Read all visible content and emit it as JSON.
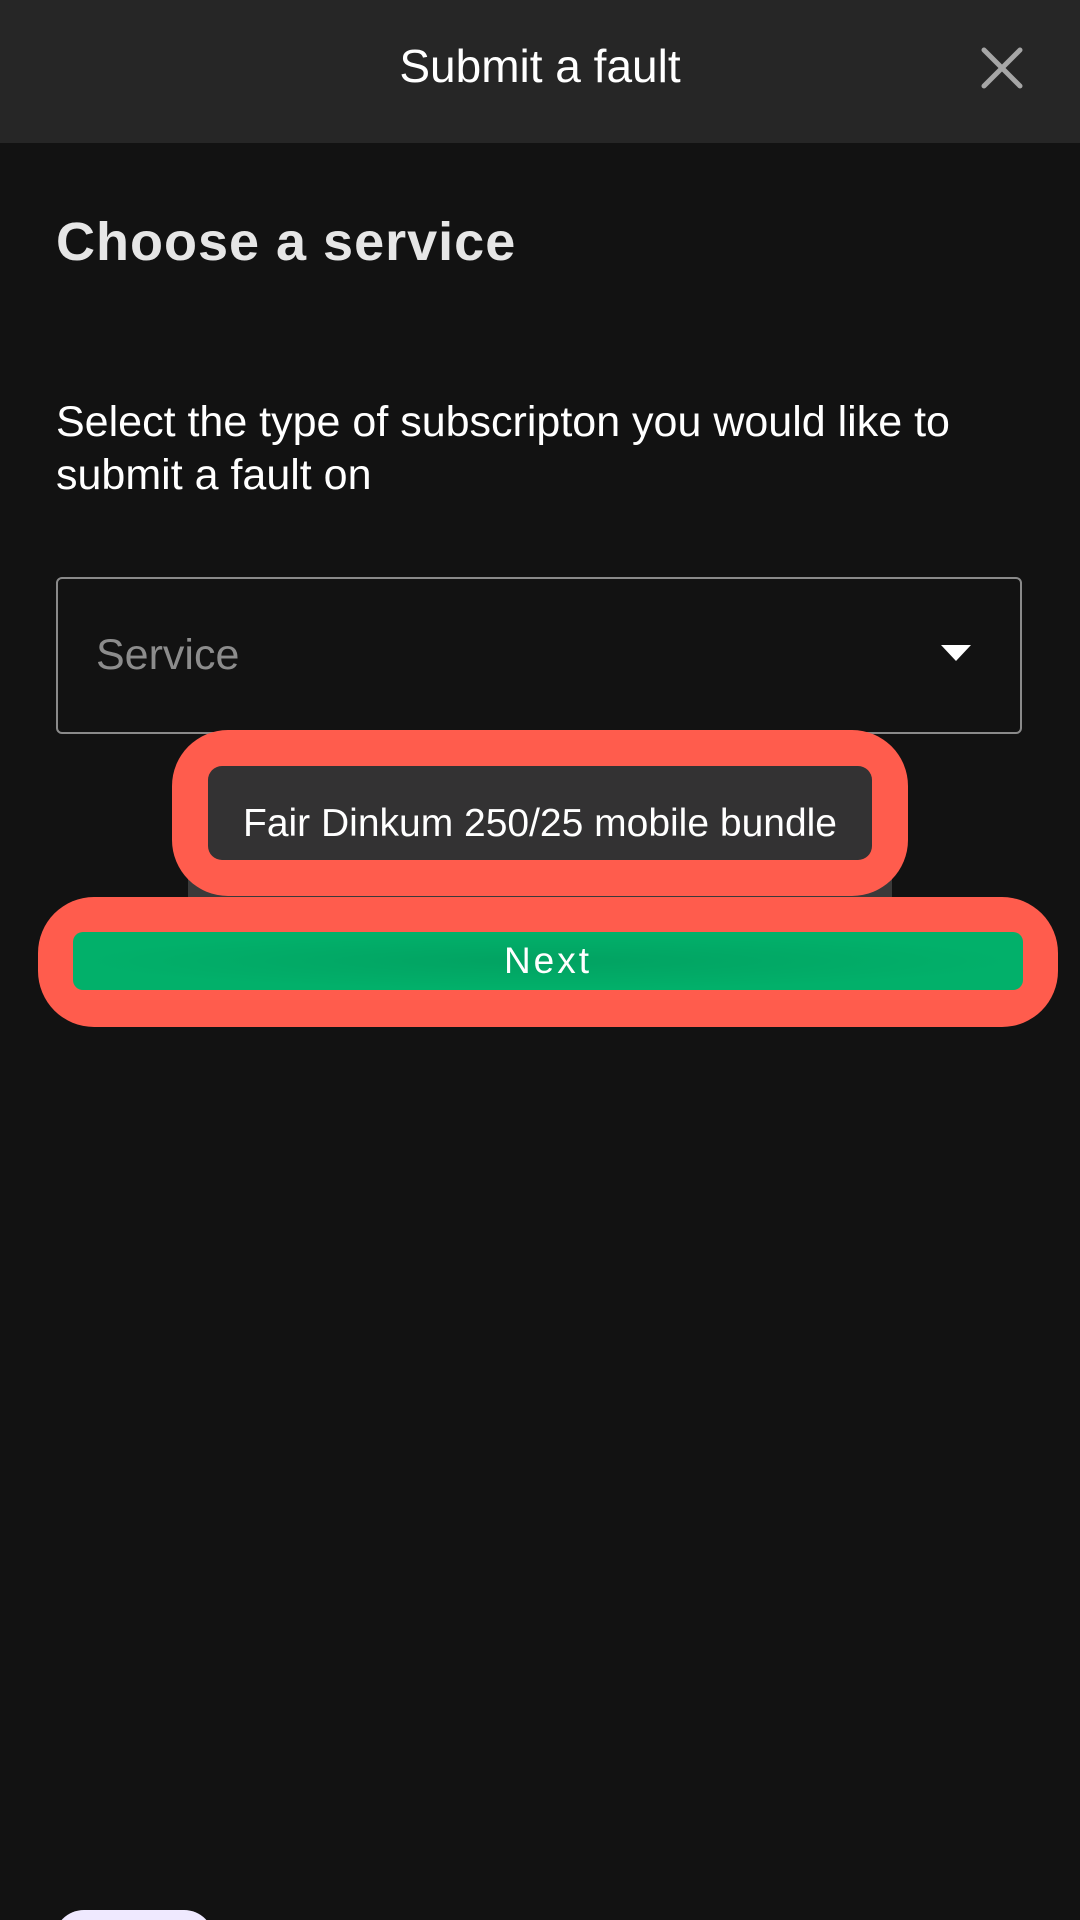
{
  "header": {
    "title": "Submit a fault",
    "close_icon": "close-icon"
  },
  "main": {
    "heading": "Choose a service",
    "instruction": "Select the type of subscripton you would like to submit a fault on",
    "service_select": {
      "placeholder": "Service",
      "caret_icon": "caret-down-icon"
    },
    "dropdown": {
      "options": [
        {
          "label": "Fair Dinkum 250/25 mobile bundle"
        }
      ]
    },
    "next_label": "Next"
  },
  "colors": {
    "background": "#121212",
    "header": "#262626",
    "accent_green": "#02b06a",
    "highlight": "#ff5c4d",
    "bubble": "#efe9ff"
  }
}
